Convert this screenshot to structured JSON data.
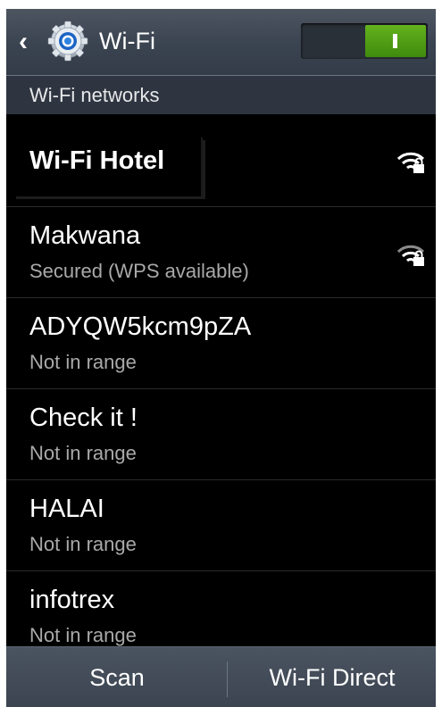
{
  "actionbar": {
    "title": "Wi-Fi",
    "toggle_state": "on",
    "toggle_color": "#4f9f17"
  },
  "section_header": "Wi-Fi networks",
  "networks": [
    {
      "name": "Wi-Fi Hotel",
      "status": "",
      "secured_icon": "wifi-lock-icon"
    },
    {
      "name": "Makwana",
      "status": "Secured (WPS available)",
      "secured_icon": "wifi-lock-icon"
    },
    {
      "name": "ADYQW5kcm9pZA",
      "status": "Not in range"
    },
    {
      "name": "Check it !",
      "status": "Not in range"
    },
    {
      "name": "HALAI",
      "status": "Not in range"
    },
    {
      "name": "infotrex",
      "status": "Not in range"
    }
  ],
  "bottombar": {
    "scan_label": "Scan",
    "wifi_direct_label": "Wi-Fi Direct"
  }
}
